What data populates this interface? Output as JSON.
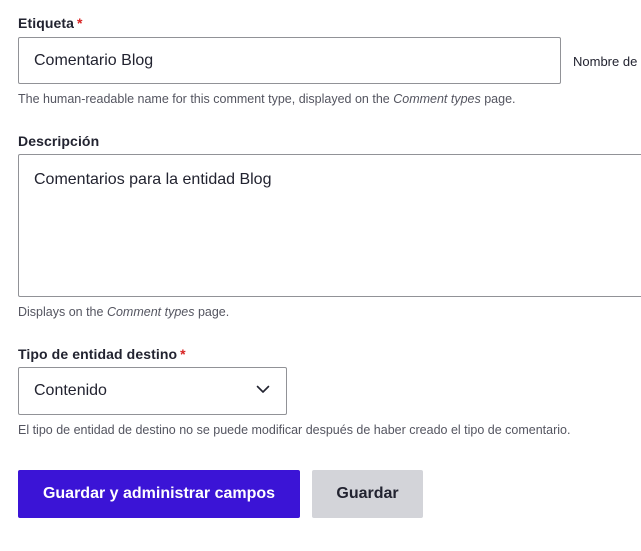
{
  "label_field": {
    "label": "Etiqueta",
    "required_mark": "*",
    "value": "Comentario Blog",
    "machine_name_prefix": "Nombre de",
    "description_pre": "The human-readable name for this comment type, displayed on the ",
    "description_em": "Comment types",
    "description_post": " page."
  },
  "description_field": {
    "label": "Descripción",
    "value": "Comentarios para la entidad Blog",
    "description_pre": "Displays on the ",
    "description_em": "Comment types",
    "description_post": " page."
  },
  "target_entity_field": {
    "label": "Tipo de entidad destino",
    "required_mark": "*",
    "selected": "Contenido",
    "description": "El tipo de entidad de destino no se puede modificar después de haber creado el tipo de comentario."
  },
  "actions": {
    "save_manage_label": "Guardar y administrar campos",
    "save_label": "Guardar"
  },
  "colors": {
    "primary": "#3b14d6",
    "secondary": "#d3d4d9",
    "required": "#d72222"
  }
}
